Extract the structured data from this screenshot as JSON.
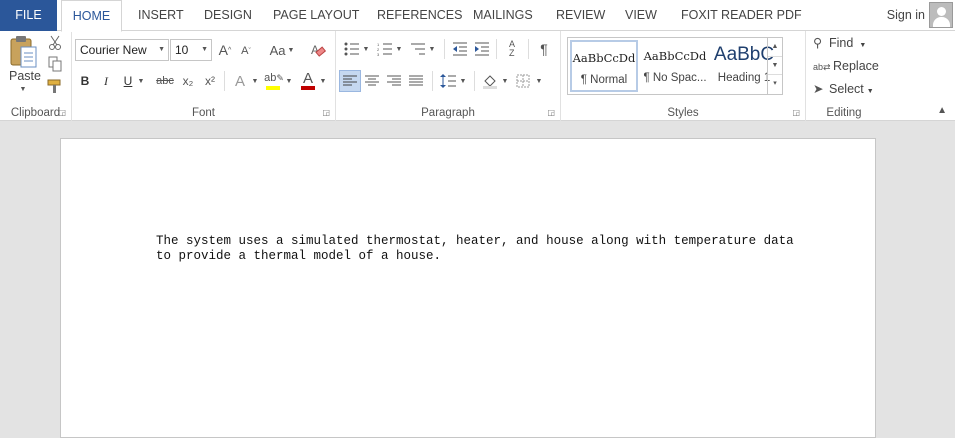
{
  "tabs": {
    "file": "FILE",
    "home": "HOME",
    "insert": "INSERT",
    "design": "DESIGN",
    "page_layout": "PAGE LAYOUT",
    "references": "REFERENCES",
    "mailings": "MAILINGS",
    "review": "REVIEW",
    "view": "VIEW",
    "foxit": "FOXIT READER PDF"
  },
  "account": {
    "sign_in": "Sign in"
  },
  "clipboard": {
    "paste_label": "Paste",
    "group_label": "Clipboard"
  },
  "font": {
    "font_name": "Courier New",
    "font_size": "10",
    "bold": "B",
    "italic": "I",
    "underline": "U",
    "strikethrough": "abc",
    "subscript": "x₂",
    "superscript": "x²",
    "group_label": "Font",
    "highlight_color": "#ffff00",
    "font_color": "#c00000"
  },
  "paragraph": {
    "group_label": "Paragraph"
  },
  "styles": {
    "items": [
      {
        "preview": "AaBbCcDd",
        "name": "¶ Normal"
      },
      {
        "preview": "AaBbCcDd",
        "name": "¶ No Spac..."
      },
      {
        "preview": "AaBbC",
        "name": "Heading 1"
      }
    ],
    "group_label": "Styles"
  },
  "editing": {
    "find": "Find",
    "replace": "Replace",
    "select": "Select",
    "group_label": "Editing"
  },
  "document": {
    "body": "The system uses a simulated thermostat, heater, and house along with temperature data to provide a thermal model of a house."
  }
}
